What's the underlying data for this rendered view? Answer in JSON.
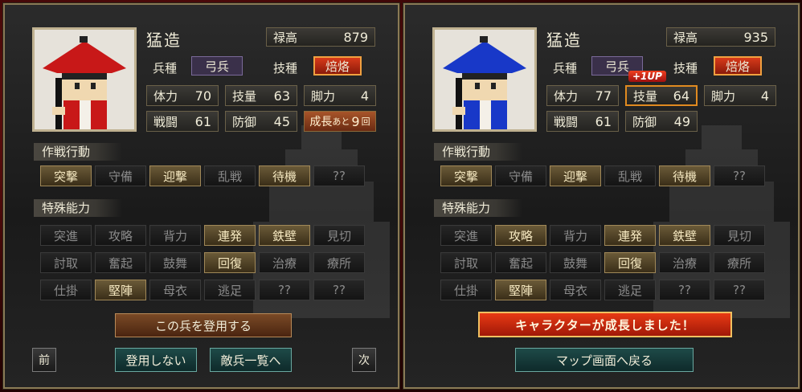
{
  "left": {
    "name": "猛造",
    "portrait_hat_color": "#c81818",
    "portrait_body_color": "#c81818",
    "salary": {
      "label": "禄高",
      "value": "879"
    },
    "unit_type": {
      "label": "兵種",
      "value": "弓兵"
    },
    "skill": {
      "label": "技種",
      "value": "焙烙"
    },
    "stats": [
      {
        "label": "体力",
        "value": "70"
      },
      {
        "label": "技量",
        "value": "63"
      },
      {
        "label": "脚力",
        "value": "4"
      },
      {
        "label": "戦闘",
        "value": "61"
      },
      {
        "label": "防御",
        "value": "45"
      }
    ],
    "growth": {
      "label": "成長",
      "prefix": "あと",
      "value": "9",
      "suffix": "回"
    },
    "tactics_title": "作戦行動",
    "tactics": [
      {
        "label": "突撃",
        "on": true
      },
      {
        "label": "守備",
        "on": false
      },
      {
        "label": "迎撃",
        "on": true
      },
      {
        "label": "乱戦",
        "on": false
      },
      {
        "label": "待機",
        "on": true
      },
      {
        "label": "??",
        "on": false
      }
    ],
    "abilities_title": "特殊能力",
    "abilities": [
      {
        "label": "突進",
        "on": false
      },
      {
        "label": "攻略",
        "on": false
      },
      {
        "label": "背力",
        "on": false
      },
      {
        "label": "連発",
        "on": true
      },
      {
        "label": "鉄壁",
        "on": true
      },
      {
        "label": "見切",
        "on": false
      },
      {
        "label": "討取",
        "on": false
      },
      {
        "label": "奮起",
        "on": false
      },
      {
        "label": "鼓舞",
        "on": false
      },
      {
        "label": "回復",
        "on": true
      },
      {
        "label": "治療",
        "on": false
      },
      {
        "label": "療所",
        "on": false
      },
      {
        "label": "仕掛",
        "on": false
      },
      {
        "label": "堅陣",
        "on": true
      },
      {
        "label": "母衣",
        "on": false
      },
      {
        "label": "逃足",
        "on": false
      },
      {
        "label": "??",
        "on": false
      },
      {
        "label": "??",
        "on": false
      }
    ],
    "recruit_button": "この兵を登用する",
    "prev_button": "前",
    "decline_button": "登用しない",
    "enemy_list_button": "敵兵一覧へ",
    "next_button": "次"
  },
  "right": {
    "name": "猛造",
    "portrait_hat_color": "#1838c8",
    "portrait_body_color": "#1838c8",
    "salary": {
      "label": "禄高",
      "value": "935"
    },
    "unit_type": {
      "label": "兵種",
      "value": "弓兵"
    },
    "skill": {
      "label": "技種",
      "value": "焙烙"
    },
    "stats": [
      {
        "label": "体力",
        "value": "77"
      },
      {
        "label": "技量",
        "value": "64"
      },
      {
        "label": "脚力",
        "value": "4"
      },
      {
        "label": "戦闘",
        "value": "61"
      },
      {
        "label": "防御",
        "value": "49"
      }
    ],
    "level_up_badge": "+1UP",
    "tactics_title": "作戦行動",
    "tactics": [
      {
        "label": "突撃",
        "on": true
      },
      {
        "label": "守備",
        "on": false
      },
      {
        "label": "迎撃",
        "on": true
      },
      {
        "label": "乱戦",
        "on": false
      },
      {
        "label": "待機",
        "on": true
      },
      {
        "label": "??",
        "on": false
      }
    ],
    "abilities_title": "特殊能力",
    "abilities": [
      {
        "label": "突進",
        "on": false
      },
      {
        "label": "攻略",
        "on": true
      },
      {
        "label": "背力",
        "on": false
      },
      {
        "label": "連発",
        "on": true
      },
      {
        "label": "鉄壁",
        "on": true
      },
      {
        "label": "見切",
        "on": false
      },
      {
        "label": "討取",
        "on": false
      },
      {
        "label": "奮起",
        "on": false
      },
      {
        "label": "鼓舞",
        "on": false
      },
      {
        "label": "回復",
        "on": true
      },
      {
        "label": "治療",
        "on": false
      },
      {
        "label": "療所",
        "on": false
      },
      {
        "label": "仕掛",
        "on": false
      },
      {
        "label": "堅陣",
        "on": true
      },
      {
        "label": "母衣",
        "on": false
      },
      {
        "label": "逃足",
        "on": false
      },
      {
        "label": "??",
        "on": false
      },
      {
        "label": "??",
        "on": false
      }
    ],
    "growth_message": "キャラクターが成長しました！",
    "return_button": "マップ画面へ戻る"
  }
}
